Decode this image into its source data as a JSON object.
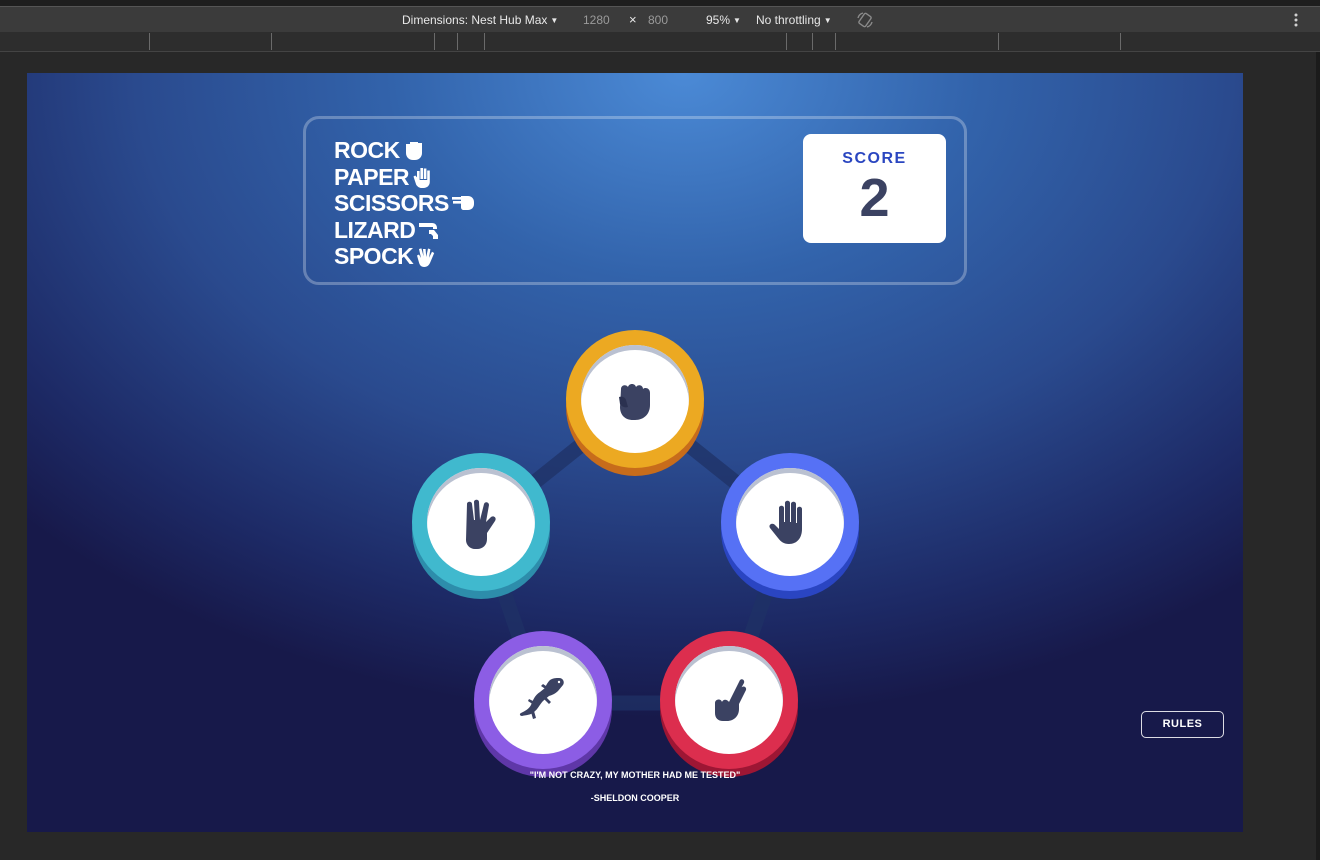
{
  "devtools": {
    "device_label": "Dimensions: Nest Hub Max",
    "width": "1280",
    "times": "×",
    "height": "800",
    "zoom": "95%",
    "throttling": "No throttling",
    "icons": [
      "chevron-down-icon",
      "rotate-icon",
      "more-vert-icon"
    ]
  },
  "game": {
    "title_lines": [
      "ROCK",
      "PAPER",
      "SCISSORS",
      "LIZARD",
      "SPOCK"
    ],
    "title_icons": [
      "fist-icon",
      "open-hand-icon",
      "scissors-hand-icon",
      "lizard-hand-icon",
      "spock-hand-icon"
    ],
    "score_label": "SCORE",
    "score_value": "2",
    "choices": [
      {
        "name": "rock",
        "icon": "rock-icon",
        "color": "#eca922",
        "edge": "#c76c1b"
      },
      {
        "name": "paper",
        "icon": "paper-icon",
        "color": "#5671f5",
        "edge": "#2a45c2"
      },
      {
        "name": "scissors",
        "icon": "scissors-icon",
        "color": "#dc2e4e",
        "edge": "#9d1634"
      },
      {
        "name": "lizard",
        "icon": "lizard-icon",
        "color": "#8c5de5",
        "edge": "#5f37a8"
      },
      {
        "name": "spock",
        "icon": "spock-icon",
        "color": "#40b9ce",
        "edge": "#2d8dab"
      }
    ],
    "rules_label": "RULES",
    "quote": "\"I'M NOT CRAZY, MY MOTHER HAD ME TESTED\"",
    "author": "-SHELDON COOPER"
  }
}
